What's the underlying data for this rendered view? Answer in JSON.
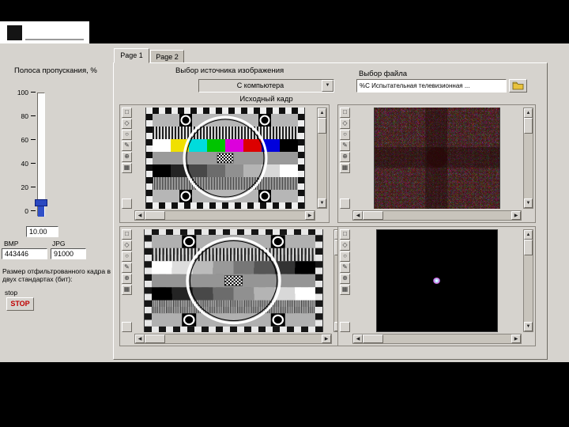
{
  "tabs": {
    "page1": "Page 1",
    "page2": "Page 2"
  },
  "bandwidth": {
    "label": "Полоса пропускания, %",
    "ticks": [
      "100",
      "80",
      "60",
      "40",
      "20",
      "0"
    ],
    "value": "10.00"
  },
  "frame_size": {
    "caption": "Размер отфильтрованного кадра в двух стандартах (бит):",
    "bmp_label": "BMP",
    "jpg_label": "JPG",
    "bmp_value": "443446",
    "jpg_value": "91000"
  },
  "stop": {
    "label": "stop",
    "button_label": "STOP"
  },
  "source": {
    "label": "Выбор источника изображения",
    "selected": "С компьютера",
    "frame_label": "Исходный кадр"
  },
  "file": {
    "label": "Выбор файла",
    "path": "%С Испытательная телевизионная ..."
  },
  "icons": {
    "dropdown_arrow": "▼",
    "up": "▲",
    "down": "▼",
    "left": "◀",
    "right": "▶",
    "tool_select": "□",
    "tool_diamond": "◇",
    "tool_oval": "○",
    "tool_pen": "✎",
    "tool_zoom": "⊕",
    "tool_grid": "▦"
  },
  "colors": {
    "panel": "#d6d3ce",
    "stop_text": "#c00000",
    "slider_fill": "#3050c8"
  }
}
